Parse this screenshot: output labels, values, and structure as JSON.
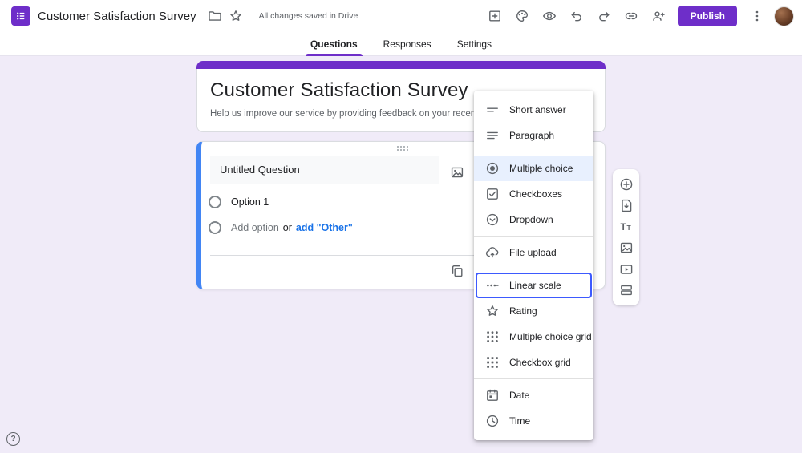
{
  "topbar": {
    "title": "Customer Satisfaction Survey",
    "saved_status": "All changes saved in Drive",
    "publish_label": "Publish"
  },
  "tabs": [
    {
      "label": "Questions",
      "active": true
    },
    {
      "label": "Responses",
      "active": false
    },
    {
      "label": "Settings",
      "active": false
    }
  ],
  "form": {
    "title": "Customer Satisfaction Survey",
    "description": "Help us improve our service by providing feedback on your recent experience",
    "question": {
      "title": "Untitled Question",
      "option1": "Option 1",
      "add_option": "Add option",
      "or": "or",
      "add_other": "add \"Other\""
    }
  },
  "type_menu": {
    "items": [
      {
        "label": "Short answer",
        "icon": "short-answer-icon"
      },
      {
        "label": "Paragraph",
        "icon": "paragraph-icon"
      },
      {
        "label": "Multiple choice",
        "icon": "multiple-choice-icon",
        "selected": true
      },
      {
        "label": "Checkboxes",
        "icon": "checkboxes-icon"
      },
      {
        "label": "Dropdown",
        "icon": "dropdown-icon"
      },
      {
        "label": "File upload",
        "icon": "file-upload-icon"
      },
      {
        "label": "Linear scale",
        "icon": "linear-scale-icon",
        "focused": true
      },
      {
        "label": "Rating",
        "icon": "rating-icon"
      },
      {
        "label": "Multiple choice grid",
        "icon": "multiple-choice-grid-icon"
      },
      {
        "label": "Checkbox grid",
        "icon": "checkbox-grid-icon"
      },
      {
        "label": "Date",
        "icon": "date-icon"
      },
      {
        "label": "Time",
        "icon": "time-icon"
      }
    ]
  },
  "side_toolbar": {
    "items": [
      "add-question",
      "import-questions",
      "add-title-description",
      "add-image",
      "add-video",
      "add-section"
    ]
  },
  "help_label": "?",
  "colors": {
    "theme_purple": "#6e2ec9",
    "accent_blue": "#4285f4",
    "link_blue": "#1a73e8",
    "menu_selected_bg": "#e8f0fe",
    "focus_outline": "#3d5afe",
    "page_bg": "#f0ebf8",
    "icon_gray": "#5f6368",
    "text_dark": "#202124",
    "text_gray": "#5f6368"
  }
}
